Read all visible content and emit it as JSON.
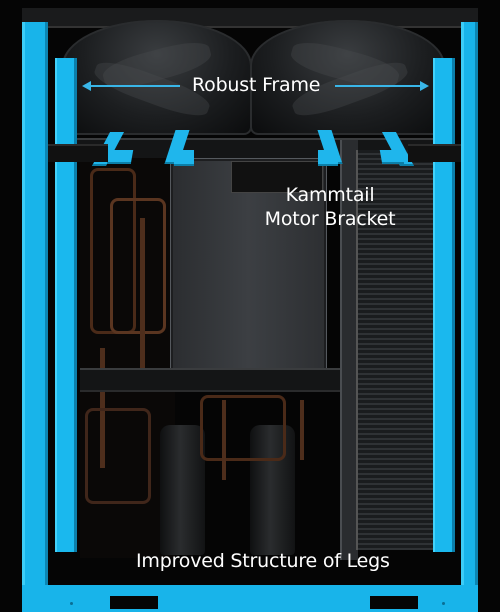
{
  "captions": {
    "robust_frame": "Robust Frame",
    "kammtail_line1": "Kammtail",
    "kammtail_line2": "Motor Bracket",
    "legs": "Improved Structure of Legs"
  },
  "colors": {
    "frame_blue": "#18b4ea",
    "arrow_blue": "#39b6e8",
    "background": "#050505",
    "text": "#ffffff"
  },
  "icons": {
    "left_arrow": "arrow-left-icon",
    "right_arrow": "arrow-right-icon"
  }
}
